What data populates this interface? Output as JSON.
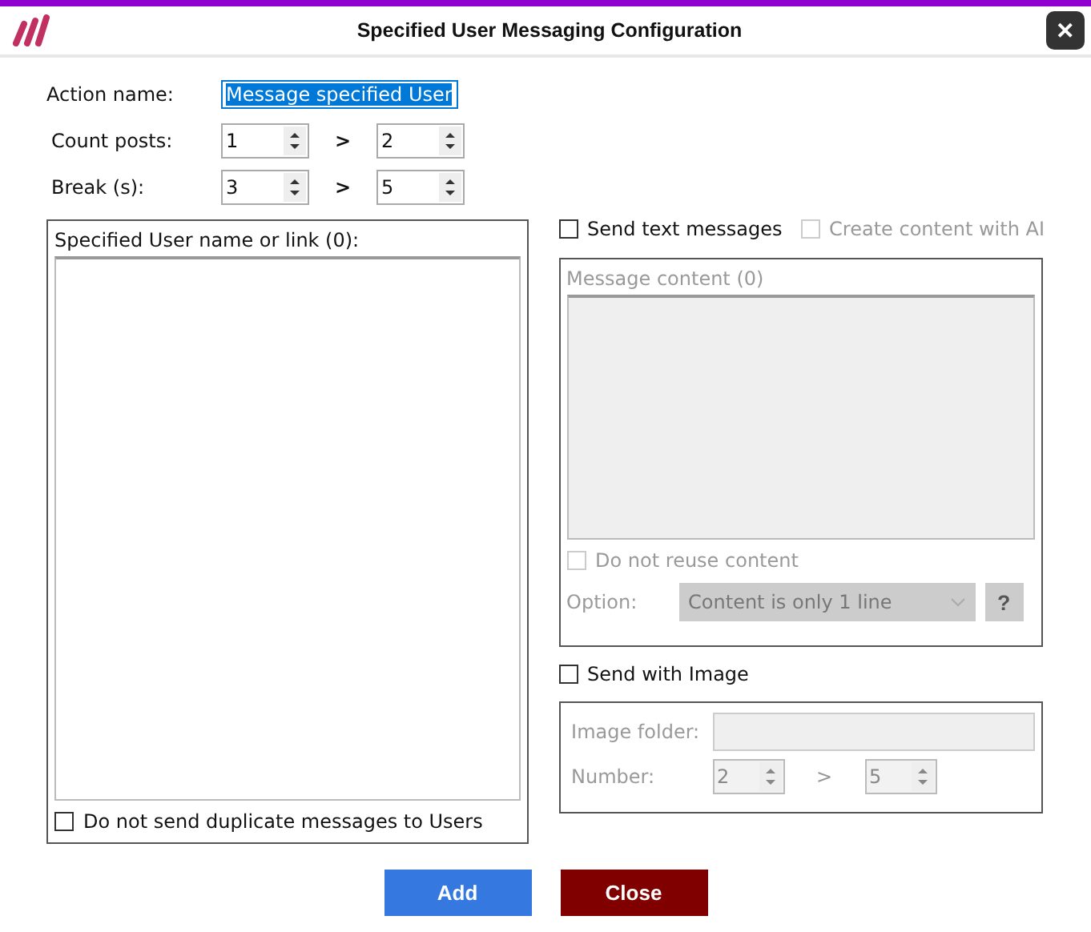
{
  "window": {
    "title": "Specified User Messaging Configuration",
    "close": "✕"
  },
  "action_name": {
    "label": "Action name:",
    "value": "Message specified User",
    "selected": true
  },
  "count_posts": {
    "label": "Count posts:",
    "from": "1",
    "separator": ">",
    "to": "2"
  },
  "break": {
    "label": "Break (s):",
    "from": "3",
    "separator": ">",
    "to": "5"
  },
  "users": {
    "label": "Specified User name or link (0):",
    "no_duplicates": {
      "label": "Do not send duplicate messages to Users",
      "checked": false
    }
  },
  "send_text": {
    "label": "Send text messages",
    "checked": false
  },
  "ai_content": {
    "label": "Create content with AI",
    "checked": false,
    "disabled": true
  },
  "message": {
    "label": "Message content (0)",
    "disabled": true,
    "no_reuse": {
      "label": "Do not reuse content",
      "checked": false,
      "disabled": true
    },
    "option": {
      "label": "Option:",
      "value": "Content is only 1 line",
      "help": "?",
      "disabled": true
    }
  },
  "send_image": {
    "label": "Send with Image",
    "checked": false
  },
  "image": {
    "disabled": true,
    "folder_label": "Image folder:",
    "number_label": "Number:",
    "from": "2",
    "separator": ">",
    "to": "5"
  },
  "buttons": [
    {
      "kind": "primary",
      "label": "Add"
    },
    {
      "kind": "danger",
      "label": "Close"
    }
  ]
}
